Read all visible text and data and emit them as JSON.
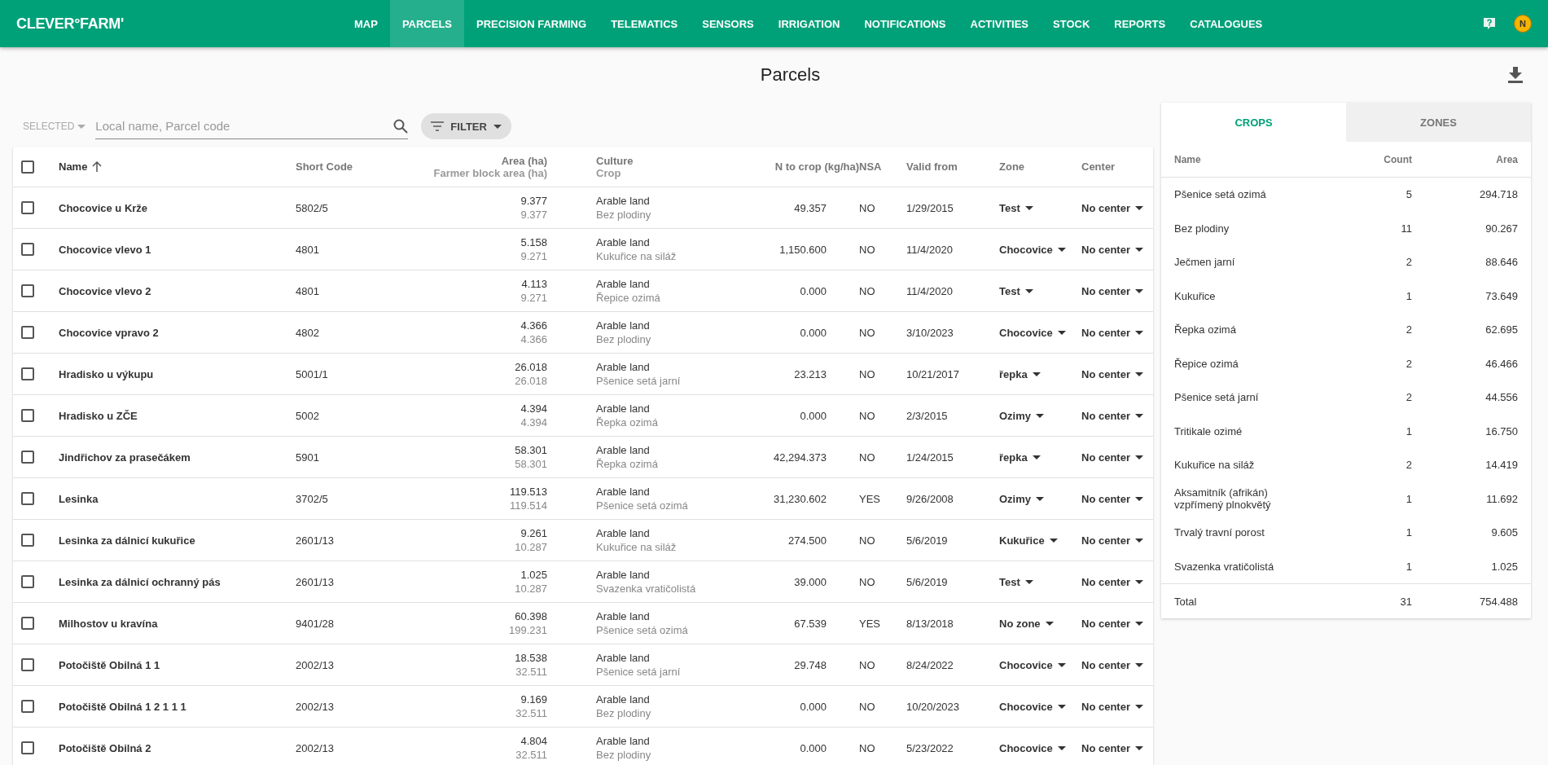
{
  "app_bar": {
    "logo": "CLEVER°FARM'",
    "nav": [
      {
        "label": "MAP",
        "selected": false
      },
      {
        "label": "PARCELS",
        "selected": true
      },
      {
        "label": "PRECISION FARMING",
        "selected": false
      },
      {
        "label": "TELEMATICS",
        "selected": false
      },
      {
        "label": "SENSORS",
        "selected": false
      },
      {
        "label": "IRRIGATION",
        "selected": false
      },
      {
        "label": "NOTIFICATIONS",
        "selected": false
      },
      {
        "label": "ACTIVITIES",
        "selected": false
      },
      {
        "label": "STOCK",
        "selected": false
      },
      {
        "label": "REPORTS",
        "selected": false
      },
      {
        "label": "CATALOGUES",
        "selected": false
      }
    ],
    "user_initial": "N"
  },
  "page_title": "Parcels",
  "toolbar": {
    "selected_menu": "SELECTED",
    "search": {
      "placeholder": "Local name, Parcel code"
    },
    "filter_button": "FILTER"
  },
  "table": {
    "select_all_checked": false,
    "columns": [
      {
        "label": "Name"
      },
      {
        "label": "Short Code"
      },
      {
        "label": "Area (ha)",
        "sublabel": "Farmer block area (ha)"
      },
      {
        "label": "Culture",
        "sublabel": "Crop"
      },
      {
        "label": "N to crop (kg/ha)"
      },
      {
        "label": "NSA"
      },
      {
        "label": "Valid from"
      },
      {
        "label": "Zone"
      },
      {
        "label": "Center"
      }
    ],
    "rows": [
      {
        "checked": false,
        "name": "Chocovice u Krže",
        "short_code": "5802/5",
        "area": "9.377",
        "block_area": "9.377",
        "culture": "Arable land",
        "crop": "Bez plodiny",
        "n_to_crop": "49.357",
        "nsa": "NO",
        "valid_from": "1/29/2015",
        "zone": "Test",
        "center": "No center"
      },
      {
        "checked": false,
        "name": "Chocovice vlevo 1",
        "short_code": "4801",
        "area": "5.158",
        "block_area": "9.271",
        "culture": "Arable land",
        "crop": "Kukuřice na siláž",
        "n_to_crop": "1,150.600",
        "nsa": "NO",
        "valid_from": "11/4/2020",
        "zone": "Chocovice",
        "center": "No center"
      },
      {
        "checked": false,
        "name": "Chocovice vlevo 2",
        "short_code": "4801",
        "area": "4.113",
        "block_area": "9.271",
        "culture": "Arable land",
        "crop": "Řepice ozimá",
        "n_to_crop": "0.000",
        "nsa": "NO",
        "valid_from": "11/4/2020",
        "zone": "Test",
        "center": "No center"
      },
      {
        "checked": false,
        "name": "Chocovice vpravo 2",
        "short_code": "4802",
        "area": "4.366",
        "block_area": "4.366",
        "culture": "Arable land",
        "crop": "Bez plodiny",
        "n_to_crop": "0.000",
        "nsa": "NO",
        "valid_from": "3/10/2023",
        "zone": "Chocovice",
        "center": "No center"
      },
      {
        "checked": false,
        "name": "Hradisko u výkupu",
        "short_code": "5001/1",
        "area": "26.018",
        "block_area": "26.018",
        "culture": "Arable land",
        "crop": "Pšenice setá jarní",
        "n_to_crop": "23.213",
        "nsa": "NO",
        "valid_from": "10/21/2017",
        "zone": "řepka",
        "center": "No center"
      },
      {
        "checked": false,
        "name": "Hradisko u ZČE",
        "short_code": "5002",
        "area": "4.394",
        "block_area": "4.394",
        "culture": "Arable land",
        "crop": "Řepka ozimá",
        "n_to_crop": "0.000",
        "nsa": "NO",
        "valid_from": "2/3/2015",
        "zone": "Ozimy",
        "center": "No center"
      },
      {
        "checked": false,
        "name": "Jindřichov za prasečákem",
        "short_code": "5901",
        "area": "58.301",
        "block_area": "58.301",
        "culture": "Arable land",
        "crop": "Řepka ozimá",
        "n_to_crop": "42,294.373",
        "nsa": "NO",
        "valid_from": "1/24/2015",
        "zone": "řepka",
        "center": "No center"
      },
      {
        "checked": false,
        "name": "Lesinka",
        "short_code": "3702/5",
        "area": "119.513",
        "block_area": "119.514",
        "culture": "Arable land",
        "crop": "Pšenice setá ozimá",
        "n_to_crop": "31,230.602",
        "nsa": "YES",
        "valid_from": "9/26/2008",
        "zone": "Ozimy",
        "center": "No center"
      },
      {
        "checked": false,
        "name": "Lesinka za dálnicí kukuřice",
        "short_code": "2601/13",
        "area": "9.261",
        "block_area": "10.287",
        "culture": "Arable land",
        "crop": "Kukuřice na siláž",
        "n_to_crop": "274.500",
        "nsa": "NO",
        "valid_from": "5/6/2019",
        "zone": "Kukuřice",
        "center": "No center"
      },
      {
        "checked": false,
        "name": "Lesinka za dálnicí ochranný pás",
        "short_code": "2601/13",
        "area": "1.025",
        "block_area": "10.287",
        "culture": "Arable land",
        "crop": "Svazenka vratičolistá",
        "n_to_crop": "39.000",
        "nsa": "NO",
        "valid_from": "5/6/2019",
        "zone": "Test",
        "center": "No center"
      },
      {
        "checked": false,
        "name": "Milhostov u kravína",
        "short_code": "9401/28",
        "area": "60.398",
        "block_area": "199.231",
        "culture": "Arable land",
        "crop": "Pšenice setá ozimá",
        "n_to_crop": "67.539",
        "nsa": "YES",
        "valid_from": "8/13/2018",
        "zone": "No zone",
        "center": "No center"
      },
      {
        "checked": false,
        "name": "Potočiště Obilná 1 1",
        "short_code": "2002/13",
        "area": "18.538",
        "block_area": "32.511",
        "culture": "Arable land",
        "crop": "Pšenice setá jarní",
        "n_to_crop": "29.748",
        "nsa": "NO",
        "valid_from": "8/24/2022",
        "zone": "Chocovice",
        "center": "No center"
      },
      {
        "checked": false,
        "name": "Potočiště Obilná 1 2 1 1 1",
        "short_code": "2002/13",
        "area": "9.169",
        "block_area": "32.511",
        "culture": "Arable land",
        "crop": "Bez plodiny",
        "n_to_crop": "0.000",
        "nsa": "NO",
        "valid_from": "10/20/2023",
        "zone": "Chocovice",
        "center": "No center"
      },
      {
        "checked": false,
        "name": "Potočiště Obilná 2",
        "short_code": "2002/13",
        "area": "4.804",
        "block_area": "32.511",
        "culture": "Arable land",
        "crop": "Bez plodiny",
        "n_to_crop": "0.000",
        "nsa": "NO",
        "valid_from": "5/23/2022",
        "zone": "Chocovice",
        "center": "No center"
      }
    ]
  },
  "summary": {
    "tabs": [
      {
        "label": "CROPS",
        "selected": true
      },
      {
        "label": "ZONES",
        "selected": false
      }
    ],
    "columns": [
      "Name",
      "Count",
      "Area"
    ],
    "rows": [
      {
        "name": "Pšenice setá ozimá",
        "count": "5",
        "area": "294.718"
      },
      {
        "name": "Bez plodiny",
        "count": "11",
        "area": "90.267"
      },
      {
        "name": "Ječmen jarní",
        "count": "2",
        "area": "88.646"
      },
      {
        "name": "Kukuřice",
        "count": "1",
        "area": "73.649"
      },
      {
        "name": "Řepka ozimá",
        "count": "2",
        "area": "62.695"
      },
      {
        "name": "Řepice ozimá",
        "count": "2",
        "area": "46.466"
      },
      {
        "name": "Pšenice setá jarní",
        "count": "2",
        "area": "44.556"
      },
      {
        "name": "Tritikale ozimé",
        "count": "1",
        "area": "16.750"
      },
      {
        "name": "Kukuřice na siláž",
        "count": "2",
        "area": "14.419"
      },
      {
        "name": "Aksamitník (afrikán) vzpřímený plnokvětý",
        "count": "1",
        "area": "11.692"
      },
      {
        "name": "Trvalý travní porost",
        "count": "1",
        "area": "9.605"
      },
      {
        "name": "Svazenka vratičolistá",
        "count": "1",
        "area": "1.025"
      }
    ],
    "total": {
      "label": "Total",
      "count": "31",
      "area": "754.488"
    }
  }
}
